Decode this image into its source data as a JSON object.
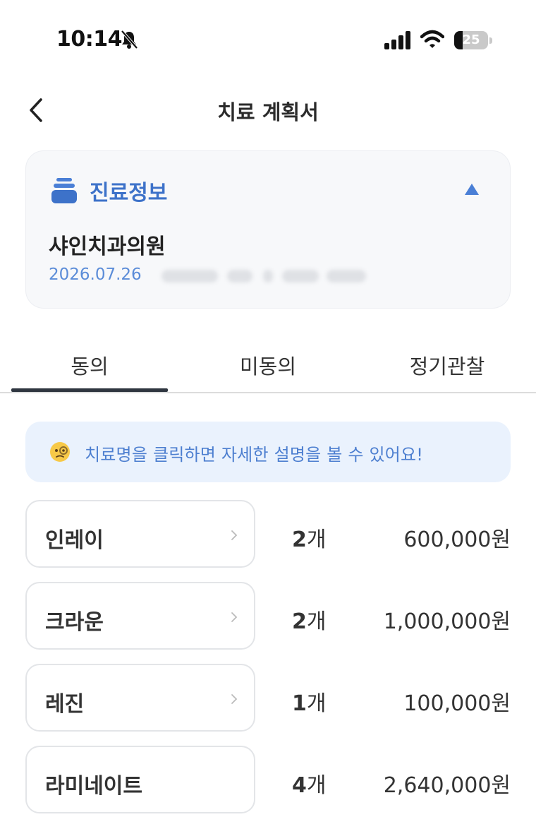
{
  "status_bar": {
    "time": "10:14",
    "battery": "25",
    "battery_level": 0.25,
    "icons": [
      "bell-slash-icon",
      "cellular-signal-icon",
      "wifi-icon",
      "battery-icon"
    ]
  },
  "nav": {
    "title": "치료 계획서",
    "back_icon": "chevron-left-icon"
  },
  "info_card": {
    "title": "진료정보",
    "icon": "stack-icon",
    "collapse_icon": "triangle-up-icon",
    "clinic_name": "샤인치과의원",
    "date": "2026.07.26"
  },
  "tabs": [
    {
      "label": "동의",
      "active": true
    },
    {
      "label": "미동의",
      "active": false
    },
    {
      "label": "정기관찰",
      "active": false
    }
  ],
  "hint": {
    "icon": "monocle-face-icon",
    "text": "치료명을 클릭하면 자세한 설명을 볼 수 있어요!"
  },
  "treatments": [
    {
      "name": "인레이",
      "count": "2",
      "unit": "개",
      "price": "600,000원",
      "has_chevron": true
    },
    {
      "name": "크라운",
      "count": "2",
      "unit": "개",
      "price": "1,000,000원",
      "has_chevron": true
    },
    {
      "name": "레진",
      "count": "1",
      "unit": "개",
      "price": "100,000원",
      "has_chevron": true
    },
    {
      "name": "라미네이트",
      "count": "4",
      "unit": "개",
      "price": "2,640,000원",
      "has_chevron": false
    }
  ],
  "colors": {
    "accent": "#3d72c9",
    "accent_light": "#5b8cd8",
    "hint_bg": "#eaf2fd",
    "card_bg": "#f7f8fa"
  }
}
